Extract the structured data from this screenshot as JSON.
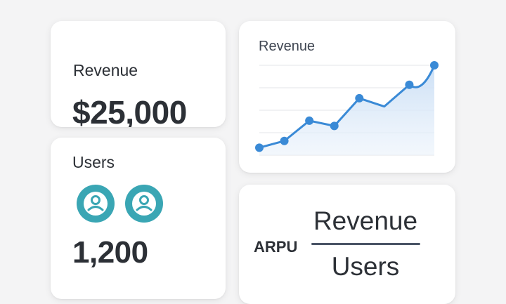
{
  "revenue_card": {
    "label": "Revenue",
    "value": "$25,000"
  },
  "users_card": {
    "label": "Users",
    "value": "1,200",
    "avatar_icon": "user-avatar-icon",
    "avatar_color": "#3aa6b4"
  },
  "chart_card": {
    "label": "Revenue"
  },
  "arpu_card": {
    "label": "ARPU",
    "numerator": "Revenue",
    "denominator": "Users"
  },
  "colors": {
    "accent": "#3a8ad6",
    "fill": "#d8e8f8",
    "avatar": "#3aa6b4"
  },
  "chart_data": {
    "type": "area",
    "title": "Revenue",
    "xlabel": "",
    "ylabel": "",
    "grid": true,
    "smooth_segment": [
      6,
      7
    ],
    "x": [
      1,
      2,
      3,
      4,
      5,
      6,
      7,
      8
    ],
    "series": [
      {
        "values": [
          1.0,
          1.9,
          4.6,
          3.9,
          7.6,
          6.5,
          9.4,
          12.0
        ]
      }
    ],
    "ylim": [
      0,
      12
    ]
  }
}
